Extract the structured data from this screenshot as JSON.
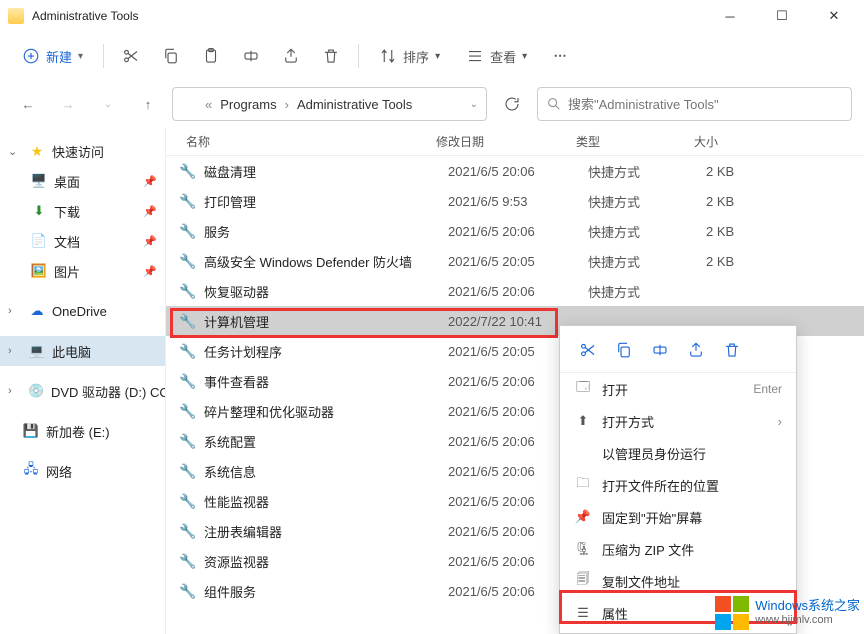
{
  "window": {
    "title": "Administrative Tools"
  },
  "toolbar": {
    "new": "新建",
    "sort": "排序",
    "view": "查看"
  },
  "breadcrumb": {
    "sep1": "«",
    "seg1": "Programs",
    "seg2": "Administrative Tools"
  },
  "search": {
    "placeholder": "搜索\"Administrative Tools\""
  },
  "sidebar": {
    "quick": "快速访问",
    "desktop": "桌面",
    "downloads": "下载",
    "documents": "文档",
    "pictures": "图片",
    "onedrive": "OneDrive",
    "thispc": "此电脑",
    "dvd": "DVD 驱动器 (D:) CC",
    "vol": "新加卷 (E:)",
    "network": "网络"
  },
  "columns": {
    "name": "名称",
    "date": "修改日期",
    "type": "类型",
    "size": "大小"
  },
  "files": [
    {
      "name": "磁盘清理",
      "date": "2021/6/5 20:06",
      "type": "快捷方式",
      "size": "2 KB"
    },
    {
      "name": "打印管理",
      "date": "2021/6/5 9:53",
      "type": "快捷方式",
      "size": "2 KB"
    },
    {
      "name": "服务",
      "date": "2021/6/5 20:06",
      "type": "快捷方式",
      "size": "2 KB"
    },
    {
      "name": "高级安全 Windows Defender 防火墙",
      "date": "2021/6/5 20:05",
      "type": "快捷方式",
      "size": "2 KB"
    },
    {
      "name": "恢复驱动器",
      "date": "2021/6/5 20:06",
      "type": "快捷方式",
      "size": ""
    },
    {
      "name": "计算机管理",
      "date": "2022/7/22 10:41",
      "type": "",
      "size": ""
    },
    {
      "name": "任务计划程序",
      "date": "2021/6/5 20:05",
      "type": "",
      "size": ""
    },
    {
      "name": "事件查看器",
      "date": "2021/6/5 20:06",
      "type": "",
      "size": ""
    },
    {
      "name": "碎片整理和优化驱动器",
      "date": "2021/6/5 20:06",
      "type": "",
      "size": ""
    },
    {
      "name": "系统配置",
      "date": "2021/6/5 20:06",
      "type": "",
      "size": ""
    },
    {
      "name": "系统信息",
      "date": "2021/6/5 20:06",
      "type": "",
      "size": ""
    },
    {
      "name": "性能监视器",
      "date": "2021/6/5 20:06",
      "type": "",
      "size": ""
    },
    {
      "name": "注册表编辑器",
      "date": "2021/6/5 20:06",
      "type": "",
      "size": ""
    },
    {
      "name": "资源监视器",
      "date": "2021/6/5 20:06",
      "type": "",
      "size": ""
    },
    {
      "name": "组件服务",
      "date": "2021/6/5 20:06",
      "type": "",
      "size": ""
    }
  ],
  "selected_index": 5,
  "context": {
    "open": "打开",
    "open_hint": "Enter",
    "openwith": "打开方式",
    "runasadmin": "以管理员身份运行",
    "openloc": "打开文件所在的位置",
    "pin": "固定到\"开始\"屏幕",
    "zip": "压缩为 ZIP 文件",
    "copypath": "复制文件地址",
    "properties": "属性"
  },
  "watermark": {
    "line1": "Windows系统之家",
    "line2": "www.bjjmlv.com"
  }
}
